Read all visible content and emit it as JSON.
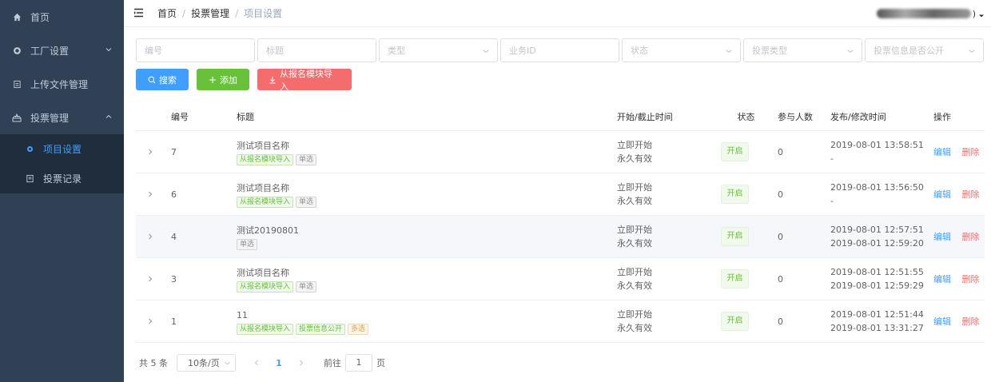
{
  "sidebar": {
    "items": [
      {
        "label": "首页"
      },
      {
        "label": "工厂设置"
      },
      {
        "label": "上传文件管理"
      },
      {
        "label": "投票管理"
      }
    ],
    "subitems": [
      {
        "label": "项目设置"
      },
      {
        "label": "投票记录"
      }
    ]
  },
  "breadcrumb": {
    "home": "首页",
    "parent": "投票管理",
    "current": "项目设置",
    "sep": "/"
  },
  "user": {
    "suffix": ")"
  },
  "filters": {
    "id": "编号",
    "title": "标题",
    "type": "类型",
    "biz_id": "业务ID",
    "status": "状态",
    "vote_type": "投票类型",
    "public": "投票信息是否公开"
  },
  "actions": {
    "search": "搜索",
    "add": "添加",
    "import": "从报名模块导入"
  },
  "table": {
    "headers": {
      "id": "编号",
      "title": "标题",
      "time": "开始/截止时间",
      "status": "状态",
      "participants": "参与人数",
      "published": "发布/修改时间",
      "ops": "操作"
    },
    "edit": "编辑",
    "delete": "删除",
    "rows": [
      {
        "id": "7",
        "title": "测试项目名称",
        "tags": [
          {
            "t": "从报名模块导入",
            "c": "green"
          },
          {
            "t": "单选",
            "c": "gray"
          }
        ],
        "start": "立即开始",
        "end": "永久有效",
        "status": "开启",
        "participants": "0",
        "pub": "2019-08-01 13:58:51",
        "mod": "-"
      },
      {
        "id": "6",
        "title": "测试项目名称",
        "tags": [
          {
            "t": "从报名模块导入",
            "c": "green"
          },
          {
            "t": "单选",
            "c": "gray"
          }
        ],
        "start": "立即开始",
        "end": "永久有效",
        "status": "开启",
        "participants": "0",
        "pub": "2019-08-01 13:56:50",
        "mod": "-"
      },
      {
        "id": "4",
        "title": "测试20190801",
        "tags": [
          {
            "t": "单选",
            "c": "gray"
          }
        ],
        "start": "立即开始",
        "end": "永久有效",
        "status": "开启",
        "participants": "0",
        "pub": "2019-08-01 12:57:51",
        "mod": "2019-08-01 12:59:20"
      },
      {
        "id": "3",
        "title": "测试项目名称",
        "tags": [
          {
            "t": "从报名模块导入",
            "c": "green"
          },
          {
            "t": "单选",
            "c": "gray"
          }
        ],
        "start": "立即开始",
        "end": "永久有效",
        "status": "开启",
        "participants": "0",
        "pub": "2019-08-01 12:51:55",
        "mod": "2019-08-01 12:59:29"
      },
      {
        "id": "1",
        "title": "11",
        "tags": [
          {
            "t": "从报名模块导入",
            "c": "green"
          },
          {
            "t": "投票信息公开",
            "c": "green"
          },
          {
            "t": "多选",
            "c": "orange"
          }
        ],
        "start": "立即开始",
        "end": "永久有效",
        "status": "开启",
        "participants": "0",
        "pub": "2019-08-01 12:51:44",
        "mod": "2019-08-01 13:31:27"
      }
    ]
  },
  "pagination": {
    "total": "共 5 条",
    "size": "10条/页",
    "page": "1",
    "goto": "前往",
    "jump": "1",
    "page_unit": "页"
  }
}
